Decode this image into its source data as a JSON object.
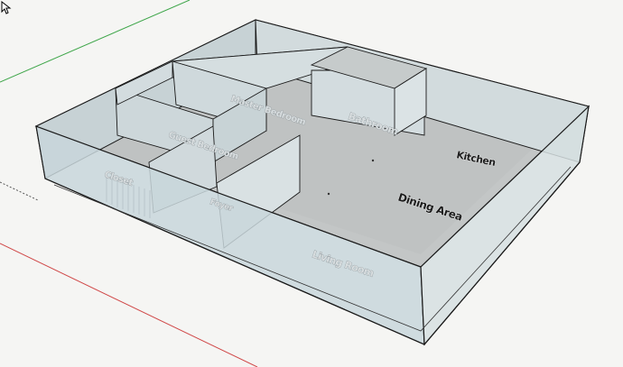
{
  "model": {
    "rooms": {
      "kitchen": "Kitchen",
      "dining_area": "Dining Area",
      "bathroom": "Bathroom",
      "master_bedroom": "Master Bedroom",
      "guest_bedroom": "Guest Bedroom",
      "closet": "Closet",
      "living_room": "Living Room",
      "foyer": "Foyer"
    }
  },
  "colors": {
    "background": "#f5f5f3",
    "floor": "#c3c6c6",
    "glass_wall": "#c8d6da",
    "edge": "#1a1a1a",
    "axis_red": "#d04848",
    "axis_green": "#3fa64a",
    "axis_black_dotted": "#555555"
  },
  "icons": {
    "cursor": "arrow-cursor-icon"
  }
}
